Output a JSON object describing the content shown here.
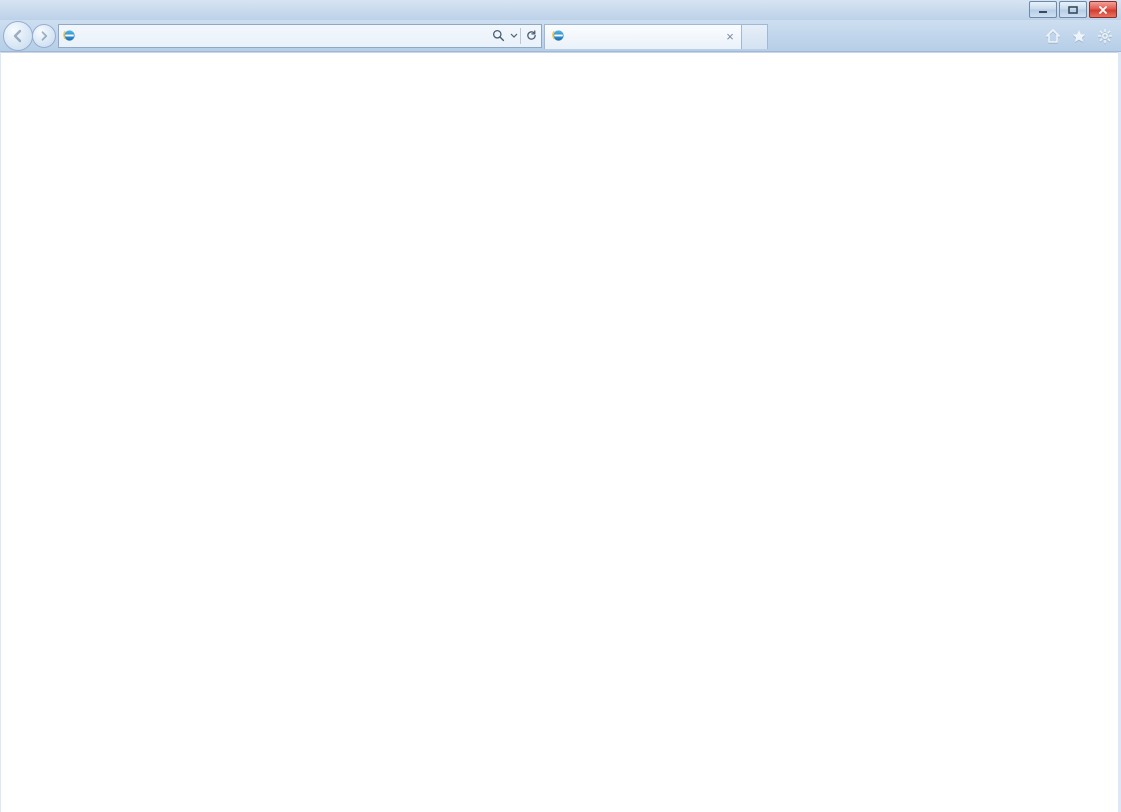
{
  "window": {
    "minimize_label": "Minimize",
    "maximize_label": "Maximize",
    "close_label": "Close"
  },
  "nav": {
    "back_label": "Back",
    "forward_label": "Forward"
  },
  "address": {
    "value": "",
    "placeholder": ""
  },
  "addrbar": {
    "search_label": "Search",
    "dropdown_label": "Search options",
    "refresh_label": "Refresh"
  },
  "tabs": [
    {
      "title": "",
      "close_label": "Close Tab"
    }
  ],
  "newtab_label": "New tab",
  "tools": {
    "home_label": "Home",
    "favorites_label": "Favorites",
    "settings_label": "Tools"
  }
}
